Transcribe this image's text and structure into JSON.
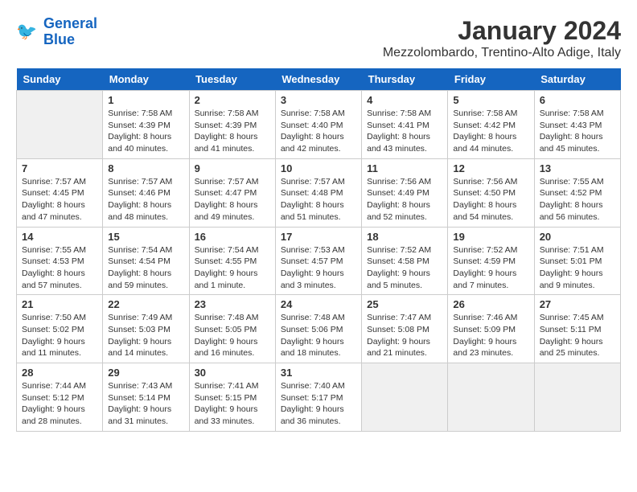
{
  "header": {
    "logo_line1": "General",
    "logo_line2": "Blue",
    "month_year": "January 2024",
    "location": "Mezzolombardo, Trentino-Alto Adige, Italy"
  },
  "days_of_week": [
    "Sunday",
    "Monday",
    "Tuesday",
    "Wednesday",
    "Thursday",
    "Friday",
    "Saturday"
  ],
  "weeks": [
    [
      {
        "day": "",
        "content": ""
      },
      {
        "day": "1",
        "content": "Sunrise: 7:58 AM\nSunset: 4:39 PM\nDaylight: 8 hours\nand 40 minutes."
      },
      {
        "day": "2",
        "content": "Sunrise: 7:58 AM\nSunset: 4:39 PM\nDaylight: 8 hours\nand 41 minutes."
      },
      {
        "day": "3",
        "content": "Sunrise: 7:58 AM\nSunset: 4:40 PM\nDaylight: 8 hours\nand 42 minutes."
      },
      {
        "day": "4",
        "content": "Sunrise: 7:58 AM\nSunset: 4:41 PM\nDaylight: 8 hours\nand 43 minutes."
      },
      {
        "day": "5",
        "content": "Sunrise: 7:58 AM\nSunset: 4:42 PM\nDaylight: 8 hours\nand 44 minutes."
      },
      {
        "day": "6",
        "content": "Sunrise: 7:58 AM\nSunset: 4:43 PM\nDaylight: 8 hours\nand 45 minutes."
      }
    ],
    [
      {
        "day": "7",
        "content": "Sunrise: 7:57 AM\nSunset: 4:45 PM\nDaylight: 8 hours\nand 47 minutes."
      },
      {
        "day": "8",
        "content": "Sunrise: 7:57 AM\nSunset: 4:46 PM\nDaylight: 8 hours\nand 48 minutes."
      },
      {
        "day": "9",
        "content": "Sunrise: 7:57 AM\nSunset: 4:47 PM\nDaylight: 8 hours\nand 49 minutes."
      },
      {
        "day": "10",
        "content": "Sunrise: 7:57 AM\nSunset: 4:48 PM\nDaylight: 8 hours\nand 51 minutes."
      },
      {
        "day": "11",
        "content": "Sunrise: 7:56 AM\nSunset: 4:49 PM\nDaylight: 8 hours\nand 52 minutes."
      },
      {
        "day": "12",
        "content": "Sunrise: 7:56 AM\nSunset: 4:50 PM\nDaylight: 8 hours\nand 54 minutes."
      },
      {
        "day": "13",
        "content": "Sunrise: 7:55 AM\nSunset: 4:52 PM\nDaylight: 8 hours\nand 56 minutes."
      }
    ],
    [
      {
        "day": "14",
        "content": "Sunrise: 7:55 AM\nSunset: 4:53 PM\nDaylight: 8 hours\nand 57 minutes."
      },
      {
        "day": "15",
        "content": "Sunrise: 7:54 AM\nSunset: 4:54 PM\nDaylight: 8 hours\nand 59 minutes."
      },
      {
        "day": "16",
        "content": "Sunrise: 7:54 AM\nSunset: 4:55 PM\nDaylight: 9 hours\nand 1 minute."
      },
      {
        "day": "17",
        "content": "Sunrise: 7:53 AM\nSunset: 4:57 PM\nDaylight: 9 hours\nand 3 minutes."
      },
      {
        "day": "18",
        "content": "Sunrise: 7:52 AM\nSunset: 4:58 PM\nDaylight: 9 hours\nand 5 minutes."
      },
      {
        "day": "19",
        "content": "Sunrise: 7:52 AM\nSunset: 4:59 PM\nDaylight: 9 hours\nand 7 minutes."
      },
      {
        "day": "20",
        "content": "Sunrise: 7:51 AM\nSunset: 5:01 PM\nDaylight: 9 hours\nand 9 minutes."
      }
    ],
    [
      {
        "day": "21",
        "content": "Sunrise: 7:50 AM\nSunset: 5:02 PM\nDaylight: 9 hours\nand 11 minutes."
      },
      {
        "day": "22",
        "content": "Sunrise: 7:49 AM\nSunset: 5:03 PM\nDaylight: 9 hours\nand 14 minutes."
      },
      {
        "day": "23",
        "content": "Sunrise: 7:48 AM\nSunset: 5:05 PM\nDaylight: 9 hours\nand 16 minutes."
      },
      {
        "day": "24",
        "content": "Sunrise: 7:48 AM\nSunset: 5:06 PM\nDaylight: 9 hours\nand 18 minutes."
      },
      {
        "day": "25",
        "content": "Sunrise: 7:47 AM\nSunset: 5:08 PM\nDaylight: 9 hours\nand 21 minutes."
      },
      {
        "day": "26",
        "content": "Sunrise: 7:46 AM\nSunset: 5:09 PM\nDaylight: 9 hours\nand 23 minutes."
      },
      {
        "day": "27",
        "content": "Sunrise: 7:45 AM\nSunset: 5:11 PM\nDaylight: 9 hours\nand 25 minutes."
      }
    ],
    [
      {
        "day": "28",
        "content": "Sunrise: 7:44 AM\nSunset: 5:12 PM\nDaylight: 9 hours\nand 28 minutes."
      },
      {
        "day": "29",
        "content": "Sunrise: 7:43 AM\nSunset: 5:14 PM\nDaylight: 9 hours\nand 31 minutes."
      },
      {
        "day": "30",
        "content": "Sunrise: 7:41 AM\nSunset: 5:15 PM\nDaylight: 9 hours\nand 33 minutes."
      },
      {
        "day": "31",
        "content": "Sunrise: 7:40 AM\nSunset: 5:17 PM\nDaylight: 9 hours\nand 36 minutes."
      },
      {
        "day": "",
        "content": ""
      },
      {
        "day": "",
        "content": ""
      },
      {
        "day": "",
        "content": ""
      }
    ]
  ]
}
